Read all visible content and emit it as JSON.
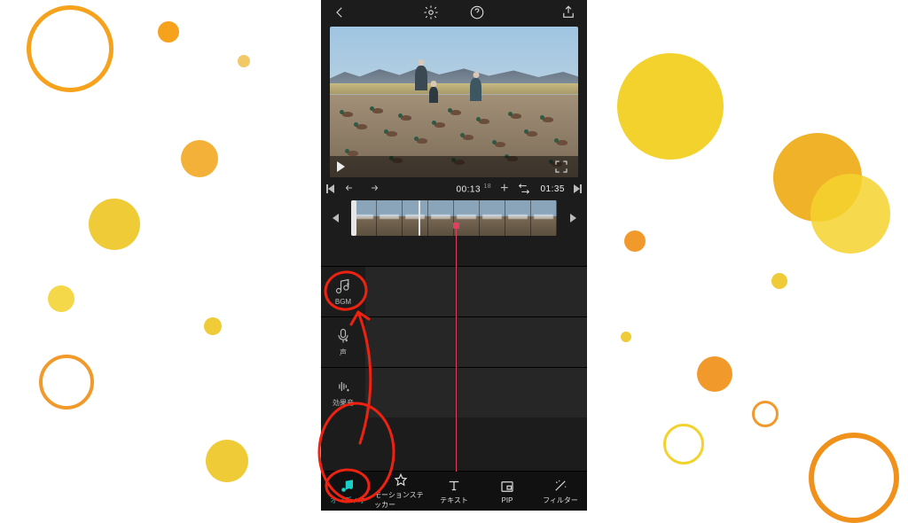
{
  "timeline": {
    "current": "00:13",
    "current_frames": "18",
    "total": "01:35"
  },
  "side_tools": [
    {
      "id": "bgm",
      "label": "BGM"
    },
    {
      "id": "voice",
      "label": "声"
    },
    {
      "id": "sfx",
      "label": "効果音"
    }
  ],
  "tabs": [
    {
      "id": "audio",
      "label": "オーディオ",
      "active": true
    },
    {
      "id": "motion",
      "label": "モーションステッカー",
      "active": false
    },
    {
      "id": "text",
      "label": "テキスト",
      "active": false
    },
    {
      "id": "pip",
      "label": "PIP",
      "active": false
    },
    {
      "id": "filter",
      "label": "フィルター",
      "active": false
    }
  ]
}
